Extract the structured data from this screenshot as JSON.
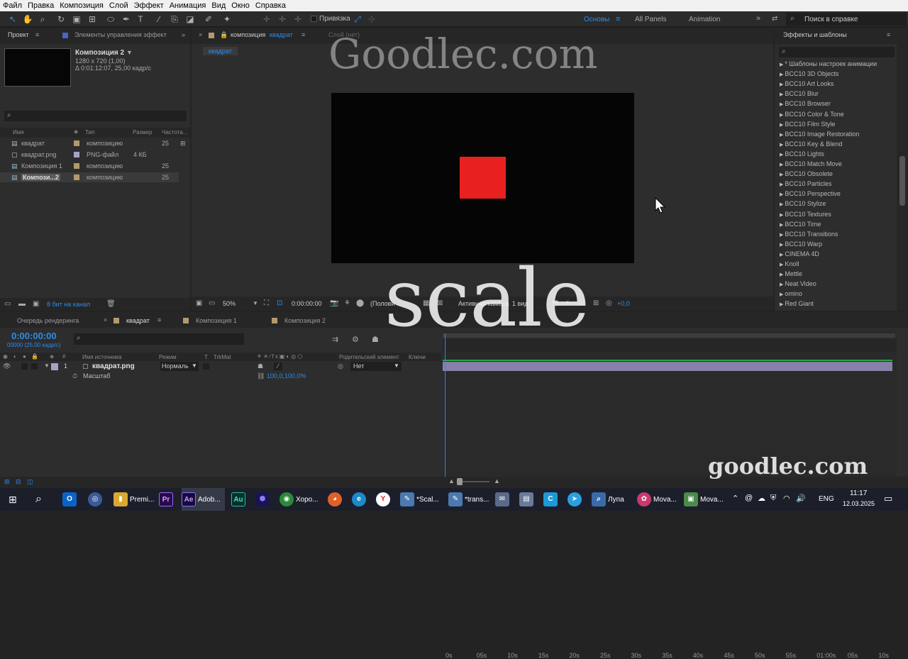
{
  "menu": [
    "Файл",
    "Правка",
    "Композиция",
    "Слой",
    "Эффект",
    "Анимация",
    "Вид",
    "Окно",
    "Справка"
  ],
  "toolbar": {
    "snap_label": "Привязка",
    "workspaces": [
      "Основы",
      "All Panels",
      "Animation"
    ],
    "help_placeholder": "Поиск в справке"
  },
  "project": {
    "tab_project": "Проект",
    "tab_effects_controls": "Элементы управления эффект",
    "comp_name": "Композиция 2",
    "comp_info_1": "1280 x 720 (1,00)",
    "comp_info_2": "Δ 0:01:12:07, 25,00 кадр/с",
    "columns": [
      "Имя",
      "Тип",
      "Размер",
      "Частота..."
    ],
    "items": [
      {
        "name": "квадрат",
        "type": "композицию",
        "size": "",
        "rate": "25"
      },
      {
        "name": "квадрат.png",
        "type": "PNG-файл",
        "size": "4 КБ",
        "rate": ""
      },
      {
        "name": "Композиция 1",
        "type": "композицию",
        "size": "",
        "rate": "25"
      },
      {
        "name": "Компози...2",
        "type": "композицию",
        "size": "",
        "rate": "25"
      }
    ],
    "bit_depth": "8 бит на канал"
  },
  "viewer": {
    "tab_comp_prefix": "композиция",
    "tab_comp_name": "квадрат",
    "tab_layer": "Слой (нет)",
    "breadcrumb": "квадрат",
    "zoom": "50%",
    "timecode": "0:00:00:00",
    "resolution": "(Полови",
    "camera": "Активная камера",
    "views": "1 вид",
    "exposure": "+0,0",
    "square_color": "#e82020"
  },
  "effects": {
    "title": "Эффекты и шаблоны",
    "items": [
      "* Шаблоны настроек анимации",
      "BCC10 3D Objects",
      "BCC10 Art Looks",
      "BCC10 Blur",
      "BCC10 Browser",
      "BCC10 Color & Tone",
      "BCC10 Film Style",
      "BCC10 Image Restoration",
      "BCC10 Key & Blend",
      "BCC10 Lights",
      "BCC10 Match Move",
      "BCC10 Obsolete",
      "BCC10 Particles",
      "BCC10 Perspective",
      "BCC10 Stylize",
      "BCC10 Textures",
      "BCC10 Time",
      "BCC10 Transitions",
      "BCC10 Warp",
      "CINEMA 4D",
      "Knoll",
      "Mettle",
      "Neat Video",
      "omino",
      "Red Giant"
    ]
  },
  "timeline": {
    "tab_render": "Очередь рендеринга",
    "tab_active": "квадрат",
    "tab_comp1": "Композиция 1",
    "tab_comp2": "Композиция 2",
    "timecode": "0:00:00:00",
    "frames": "00000 (25.00 кадр/с)",
    "columns": [
      "Имя источника",
      "Режим",
      "T",
      "TrkMat",
      "Родительский элемент",
      "Ключи"
    ],
    "layer": {
      "num": "1",
      "name": "квадрат.png",
      "mode": "Нормаль",
      "parent": "Нет"
    },
    "property": {
      "name": "Масштаб",
      "value": "100,0,100,0%"
    },
    "ruler": [
      "0s",
      "05s",
      "10s",
      "15s",
      "20s",
      "25s",
      "30s",
      "35s",
      "40s",
      "45s",
      "50s",
      "55s",
      "01:00s",
      "05s",
      "10s"
    ]
  },
  "watermarks": {
    "top": "Goodlec.com",
    "center": "scale",
    "bottom": "goodlec.com"
  },
  "taskbar": {
    "apps": [
      {
        "icon": "Pr",
        "label": "Premi..."
      },
      {
        "icon": "Ae",
        "label": "Adob..."
      },
      {
        "icon": "Au",
        "label": ""
      },
      {
        "icon": "Хо",
        "label": "Хоро..."
      },
      {
        "icon": "S",
        "label": "*Scal..."
      },
      {
        "icon": "t",
        "label": "*trans..."
      },
      {
        "icon": "Л",
        "label": "Лупа"
      },
      {
        "icon": "M",
        "label": "Mova..."
      },
      {
        "icon": "M",
        "label": "Mova..."
      }
    ],
    "lang": "ENG",
    "time": "11:17",
    "date": "12.03.2025"
  }
}
